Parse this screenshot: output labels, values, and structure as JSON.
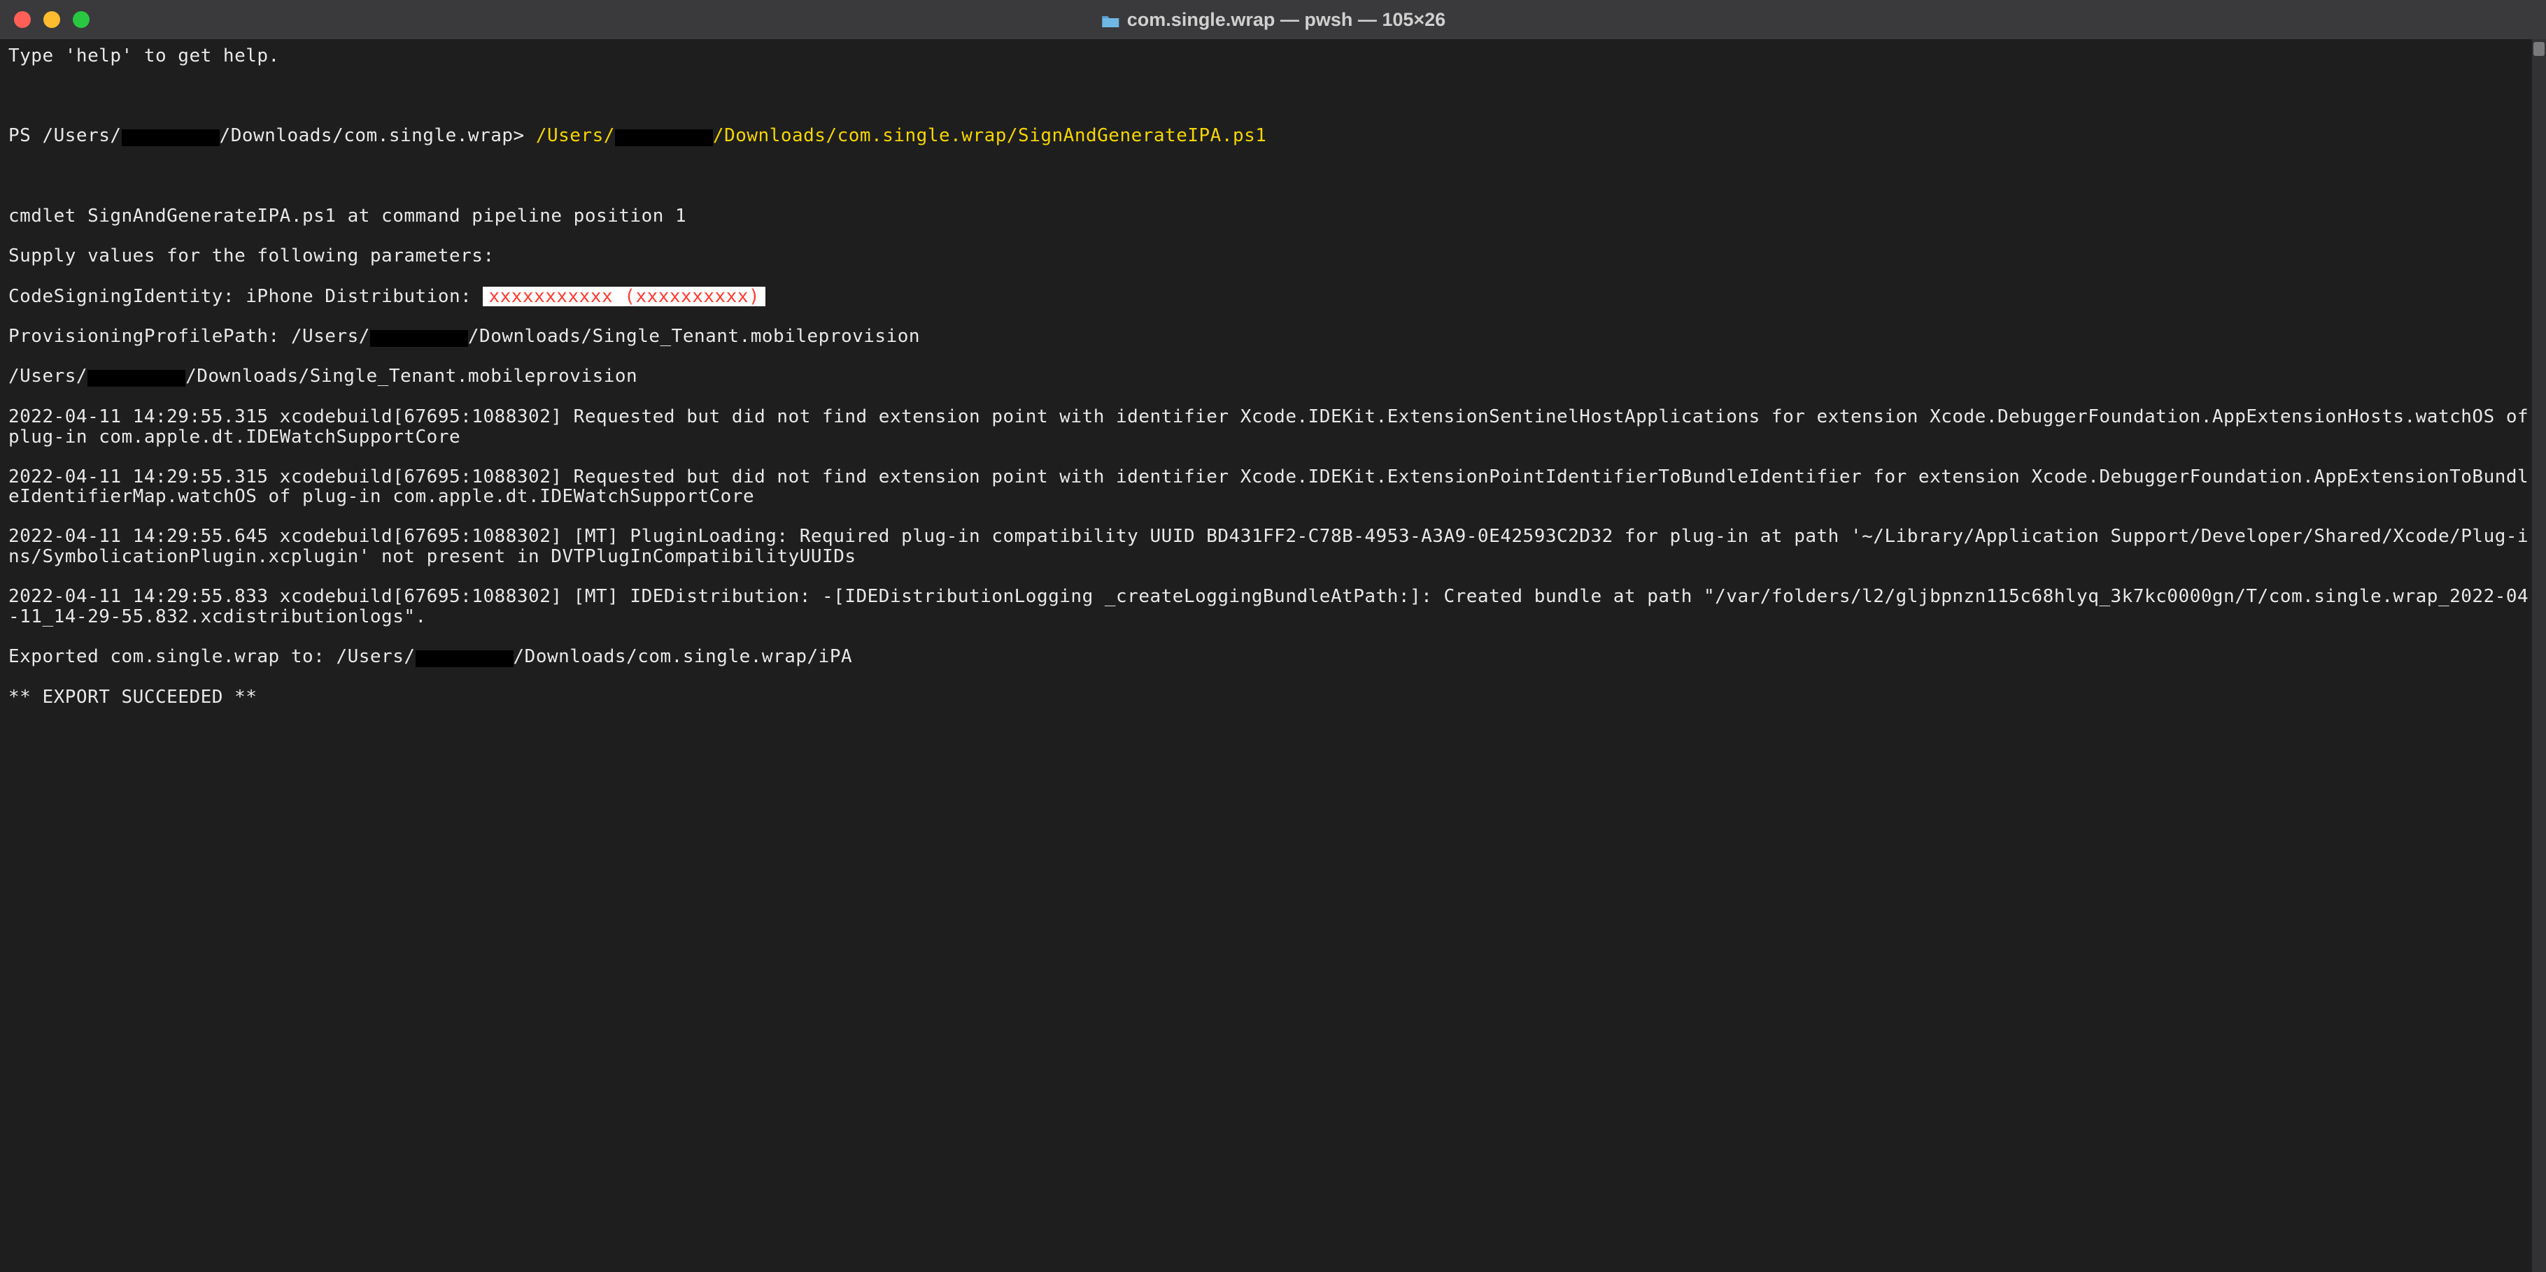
{
  "window": {
    "title": "com.single.wrap — pwsh — 105×26"
  },
  "terminal": {
    "help_line": "Type 'help' to get help.",
    "prompt_prefix": "PS /Users/",
    "prompt_path": "/Downloads/com.single.wrap> ",
    "cmd_part1": "/Users/",
    "cmd_part2": "/Downloads/com.single.wrap/SignAndGenerateIPA.ps1",
    "cmdlet_line": "cmdlet SignAndGenerateIPA.ps1 at command pipeline position 1",
    "supply_line": "Supply values for the following parameters:",
    "codesign_label": "CodeSigningIdentity: iPhone Distribution: ",
    "codesign_redacted": "xxxxxxxxxxx (xxxxxxxxxx)",
    "provprofile_label": "ProvisioningProfilePath: /Users/",
    "provprofile_path": "/Downloads/Single_Tenant.mobileprovision",
    "echo_users": "/Users/",
    "echo_path": "/Downloads/Single_Tenant.mobileprovision",
    "log1": "2022-04-11 14:29:55.315 xcodebuild[67695:1088302] Requested but did not find extension point with identifier Xcode.IDEKit.ExtensionSentinelHostApplications for extension Xcode.DebuggerFoundation.AppExtensionHosts.watchOS of plug-in com.apple.dt.IDEWatchSupportCore",
    "log2": "2022-04-11 14:29:55.315 xcodebuild[67695:1088302] Requested but did not find extension point with identifier Xcode.IDEKit.ExtensionPointIdentifierToBundleIdentifier for extension Xcode.DebuggerFoundation.AppExtensionToBundleIdentifierMap.watchOS of plug-in com.apple.dt.IDEWatchSupportCore",
    "log3": "2022-04-11 14:29:55.645 xcodebuild[67695:1088302] [MT] PluginLoading: Required plug-in compatibility UUID BD431FF2-C78B-4953-A3A9-0E42593C2D32 for plug-in at path '~/Library/Application Support/Developer/Shared/Xcode/Plug-ins/SymbolicationPlugin.xcplugin' not present in DVTPlugInCompatibilityUUIDs",
    "log4": "2022-04-11 14:29:55.833 xcodebuild[67695:1088302] [MT] IDEDistribution: -[IDEDistributionLogging _createLoggingBundleAtPath:]: Created bundle at path \"/var/folders/l2/gljbpnzn115c68hlyq_3k7kc0000gn/T/com.single.wrap_2022-04-11_14-29-55.832.xcdistributionlogs\".",
    "exported_prefix": "Exported com.single.wrap to: /Users/",
    "exported_suffix": "/Downloads/com.single.wrap/iPA",
    "succeeded": "** EXPORT SUCCEEDED **"
  }
}
